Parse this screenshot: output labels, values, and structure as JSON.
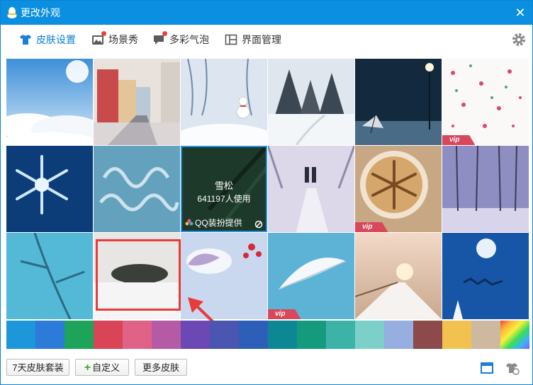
{
  "window": {
    "title": "更改外观",
    "close_symbol": "✕"
  },
  "tabs": [
    {
      "label": "皮肤设置",
      "icon": "shirt-icon",
      "active": true
    },
    {
      "label": "场景秀",
      "icon": "image-icon",
      "badge": true
    },
    {
      "label": "多彩气泡",
      "icon": "chat-bubble-icon",
      "badge": true
    },
    {
      "label": "界面管理",
      "icon": "layout-icon"
    }
  ],
  "hover_skin": {
    "name": "雪松",
    "users": "641197人使用",
    "provider": "QQ装扮提供"
  },
  "vip_label": "vip",
  "swatch_colors": [
    "#1e96da",
    "#2d7bd9",
    "#1ea35a",
    "#d94457",
    "#e06287",
    "#b55aa5",
    "#6b48b4",
    "#4a56b0",
    "#2e5fb8",
    "#0e8795",
    "#159a7d",
    "#3db3a7",
    "#7dcfca",
    "#96aee0",
    "#8c4a4a",
    "#f2c251",
    "#cdb8a0",
    "rainbow"
  ],
  "buttons": {
    "package": "7天皮肤套装",
    "custom": "自定义",
    "more": "更多皮肤"
  },
  "colors": {
    "titlebar": "#0b8fe1",
    "accent": "#0b7fd4",
    "highlight": "#e83b3b"
  }
}
